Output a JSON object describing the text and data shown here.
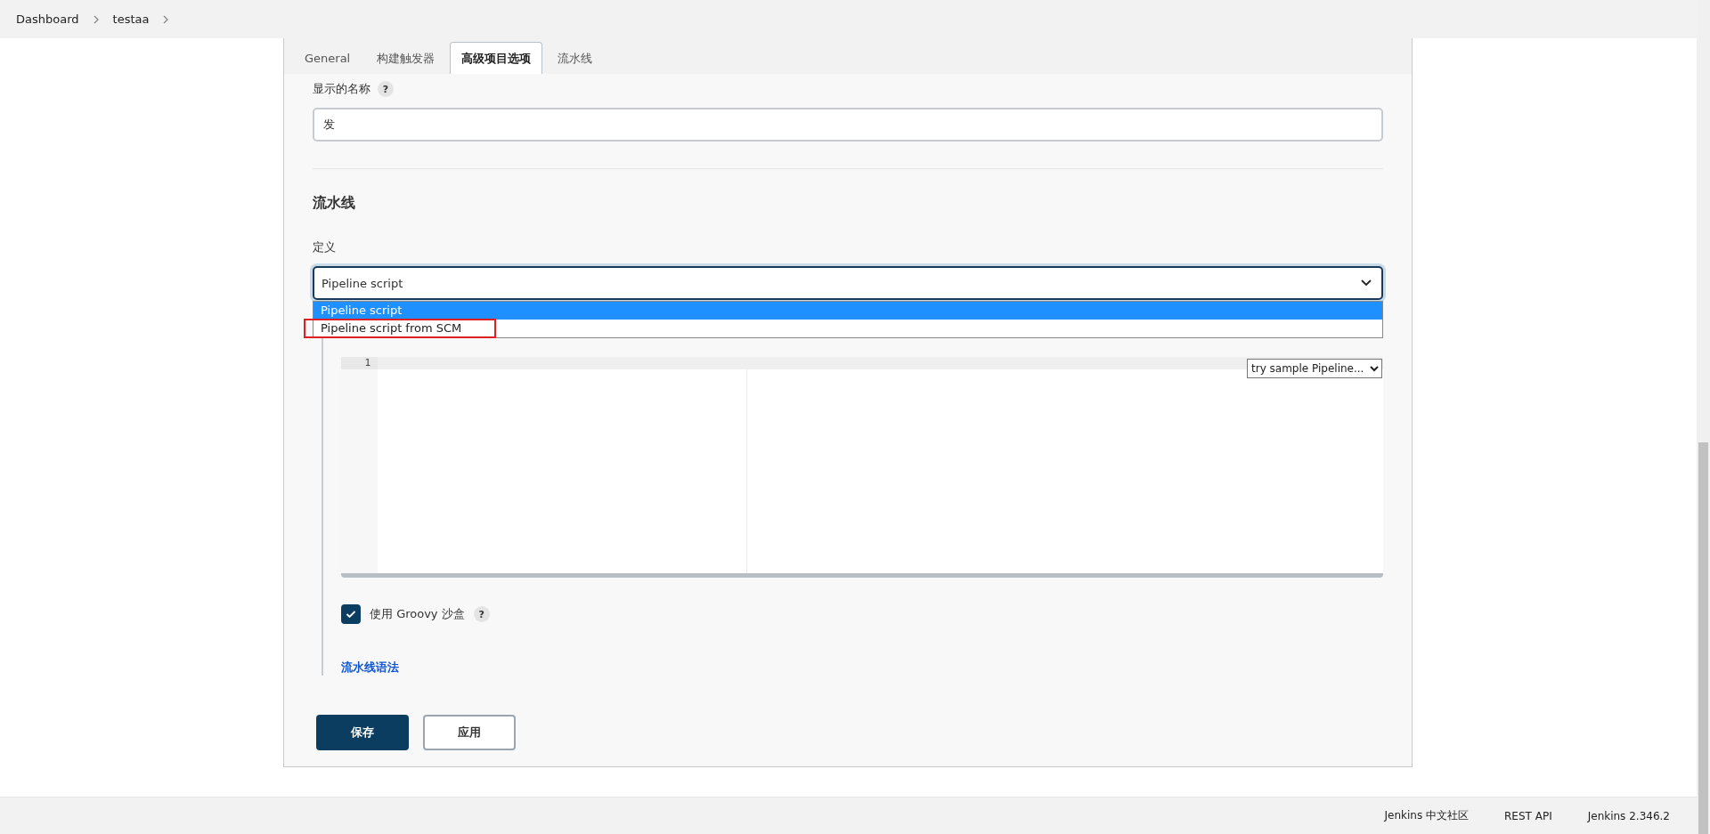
{
  "breadcrumbs": [
    {
      "label": "Dashboard"
    },
    {
      "label": "testaa"
    }
  ],
  "tabs": [
    {
      "label": "General",
      "selected": false
    },
    {
      "label": "构建触发器",
      "selected": false
    },
    {
      "label": "高级项目选项",
      "selected": true
    },
    {
      "label": "流水线",
      "selected": false
    }
  ],
  "display_name": {
    "label": "显示的名称",
    "help": "?",
    "value": "发"
  },
  "section": {
    "title": "流水线"
  },
  "definition": {
    "label": "定义",
    "value": "Pipeline script",
    "options": [
      {
        "label": "Pipeline script",
        "selected": true,
        "annotated": false
      },
      {
        "label": "Pipeline script from SCM",
        "selected": false,
        "annotated": true
      }
    ]
  },
  "editor": {
    "line_numbers": [
      "1"
    ],
    "sample_select": "try sample Pipeline..."
  },
  "sandbox": {
    "label": "使用 Groovy 沙盒",
    "help": "?",
    "checked": true
  },
  "syntax_link": "流水线语法",
  "buttons": [
    {
      "label": "保存",
      "kind": "primary"
    },
    {
      "label": "应用",
      "kind": "secondary"
    }
  ],
  "footer": {
    "links": [
      "Jenkins 中文社区",
      "REST API",
      "Jenkins 2.346.2"
    ]
  }
}
